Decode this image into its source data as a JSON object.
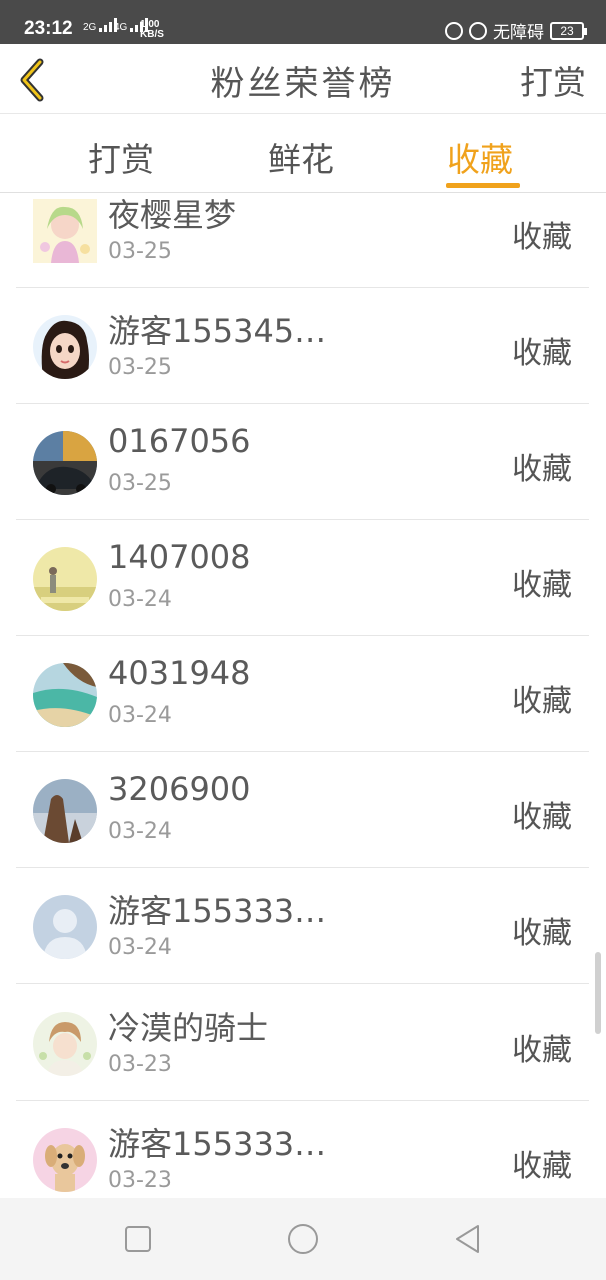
{
  "status_bar": {
    "time": "23:12",
    "net1": "2G",
    "net2": "4G",
    "speed_value": "1.00",
    "speed_unit": "KB/S",
    "accessibility": "无障碍",
    "battery": "23"
  },
  "header": {
    "title": "粉丝荣誉榜",
    "right_button": "打赏",
    "back_icon": "chevron-left-icon",
    "accent_color": "#f0a21c"
  },
  "tabs": [
    {
      "label": "打赏",
      "active": false
    },
    {
      "label": "鲜花",
      "active": false
    },
    {
      "label": "收藏",
      "active": true
    }
  ],
  "fans": [
    {
      "name": "夜樱星梦",
      "date": "03-25",
      "action": "收藏",
      "avatar": "anime-girl-avatar"
    },
    {
      "name": "游客155345…",
      "date": "03-25",
      "action": "收藏",
      "avatar": "cartoon-girl-avatar"
    },
    {
      "name": "0167056",
      "date": "03-25",
      "action": "收藏",
      "avatar": "car-street-avatar"
    },
    {
      "name": "1407008",
      "date": "03-24",
      "action": "收藏",
      "avatar": "boy-field-avatar"
    },
    {
      "name": "4031948",
      "date": "03-24",
      "action": "收藏",
      "avatar": "beach-coast-avatar"
    },
    {
      "name": "3206900",
      "date": "03-24",
      "action": "收藏",
      "avatar": "sea-rock-avatar"
    },
    {
      "name": "游客155333…",
      "date": "03-24",
      "action": "收藏",
      "avatar": "default-user-avatar"
    },
    {
      "name": "冷漠的骑士",
      "date": "03-23",
      "action": "收藏",
      "avatar": "anime-boy-avatar"
    },
    {
      "name": "游客155333…",
      "date": "03-23",
      "action": "收藏",
      "avatar": "puppy-avatar"
    }
  ],
  "nav_bar": [
    "square-recent-icon",
    "circle-home-icon",
    "triangle-back-icon"
  ]
}
